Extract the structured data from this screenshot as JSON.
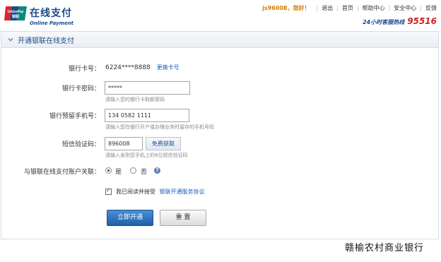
{
  "header": {
    "logo_badge": "UnionPay 银联",
    "logo_cn": "在线支付",
    "logo_en": "Online Payment",
    "greeting": "js96008，您好！",
    "nav": [
      "退出",
      "首页",
      "帮助中心",
      "安全中心",
      "反馈"
    ],
    "hotline_label": "24小时客服热线",
    "hotline_number": "95516"
  },
  "panel": {
    "title": "开通银联在线支付"
  },
  "form": {
    "card_label": "银行卡号：",
    "card_number": "6224****8888",
    "change_card": "更换卡号",
    "password_label": "银行卡密码：",
    "password_value": "*****",
    "password_hint": "请输入您的银行卡取款密码",
    "phone_label": "银行预留手机号：",
    "phone_value": "134 0582 1111",
    "phone_hint": "请输入您在银行开户或办理业务时留存的手机号码",
    "sms_label": "短信验证码：",
    "sms_value": "896008",
    "sms_button": "免费获取",
    "sms_hint": "请输入发到您手机上的6位短信验证码",
    "link_label": "与银联在线支付账户关联：",
    "link_yes": "是",
    "link_no": "否",
    "link_selected": "是",
    "agree_text": "我已阅读并接受",
    "agree_link": "银联开通服务协议",
    "agree_checked": true,
    "submit": "立即开通",
    "reset": "重 置"
  },
  "footer": {
    "bank_name": "赣榆农村商业银行"
  },
  "colors": {
    "brand_blue": "#1a4b8c",
    "hotline_red": "#cc2222",
    "greeting_orange": "#d47a00"
  }
}
